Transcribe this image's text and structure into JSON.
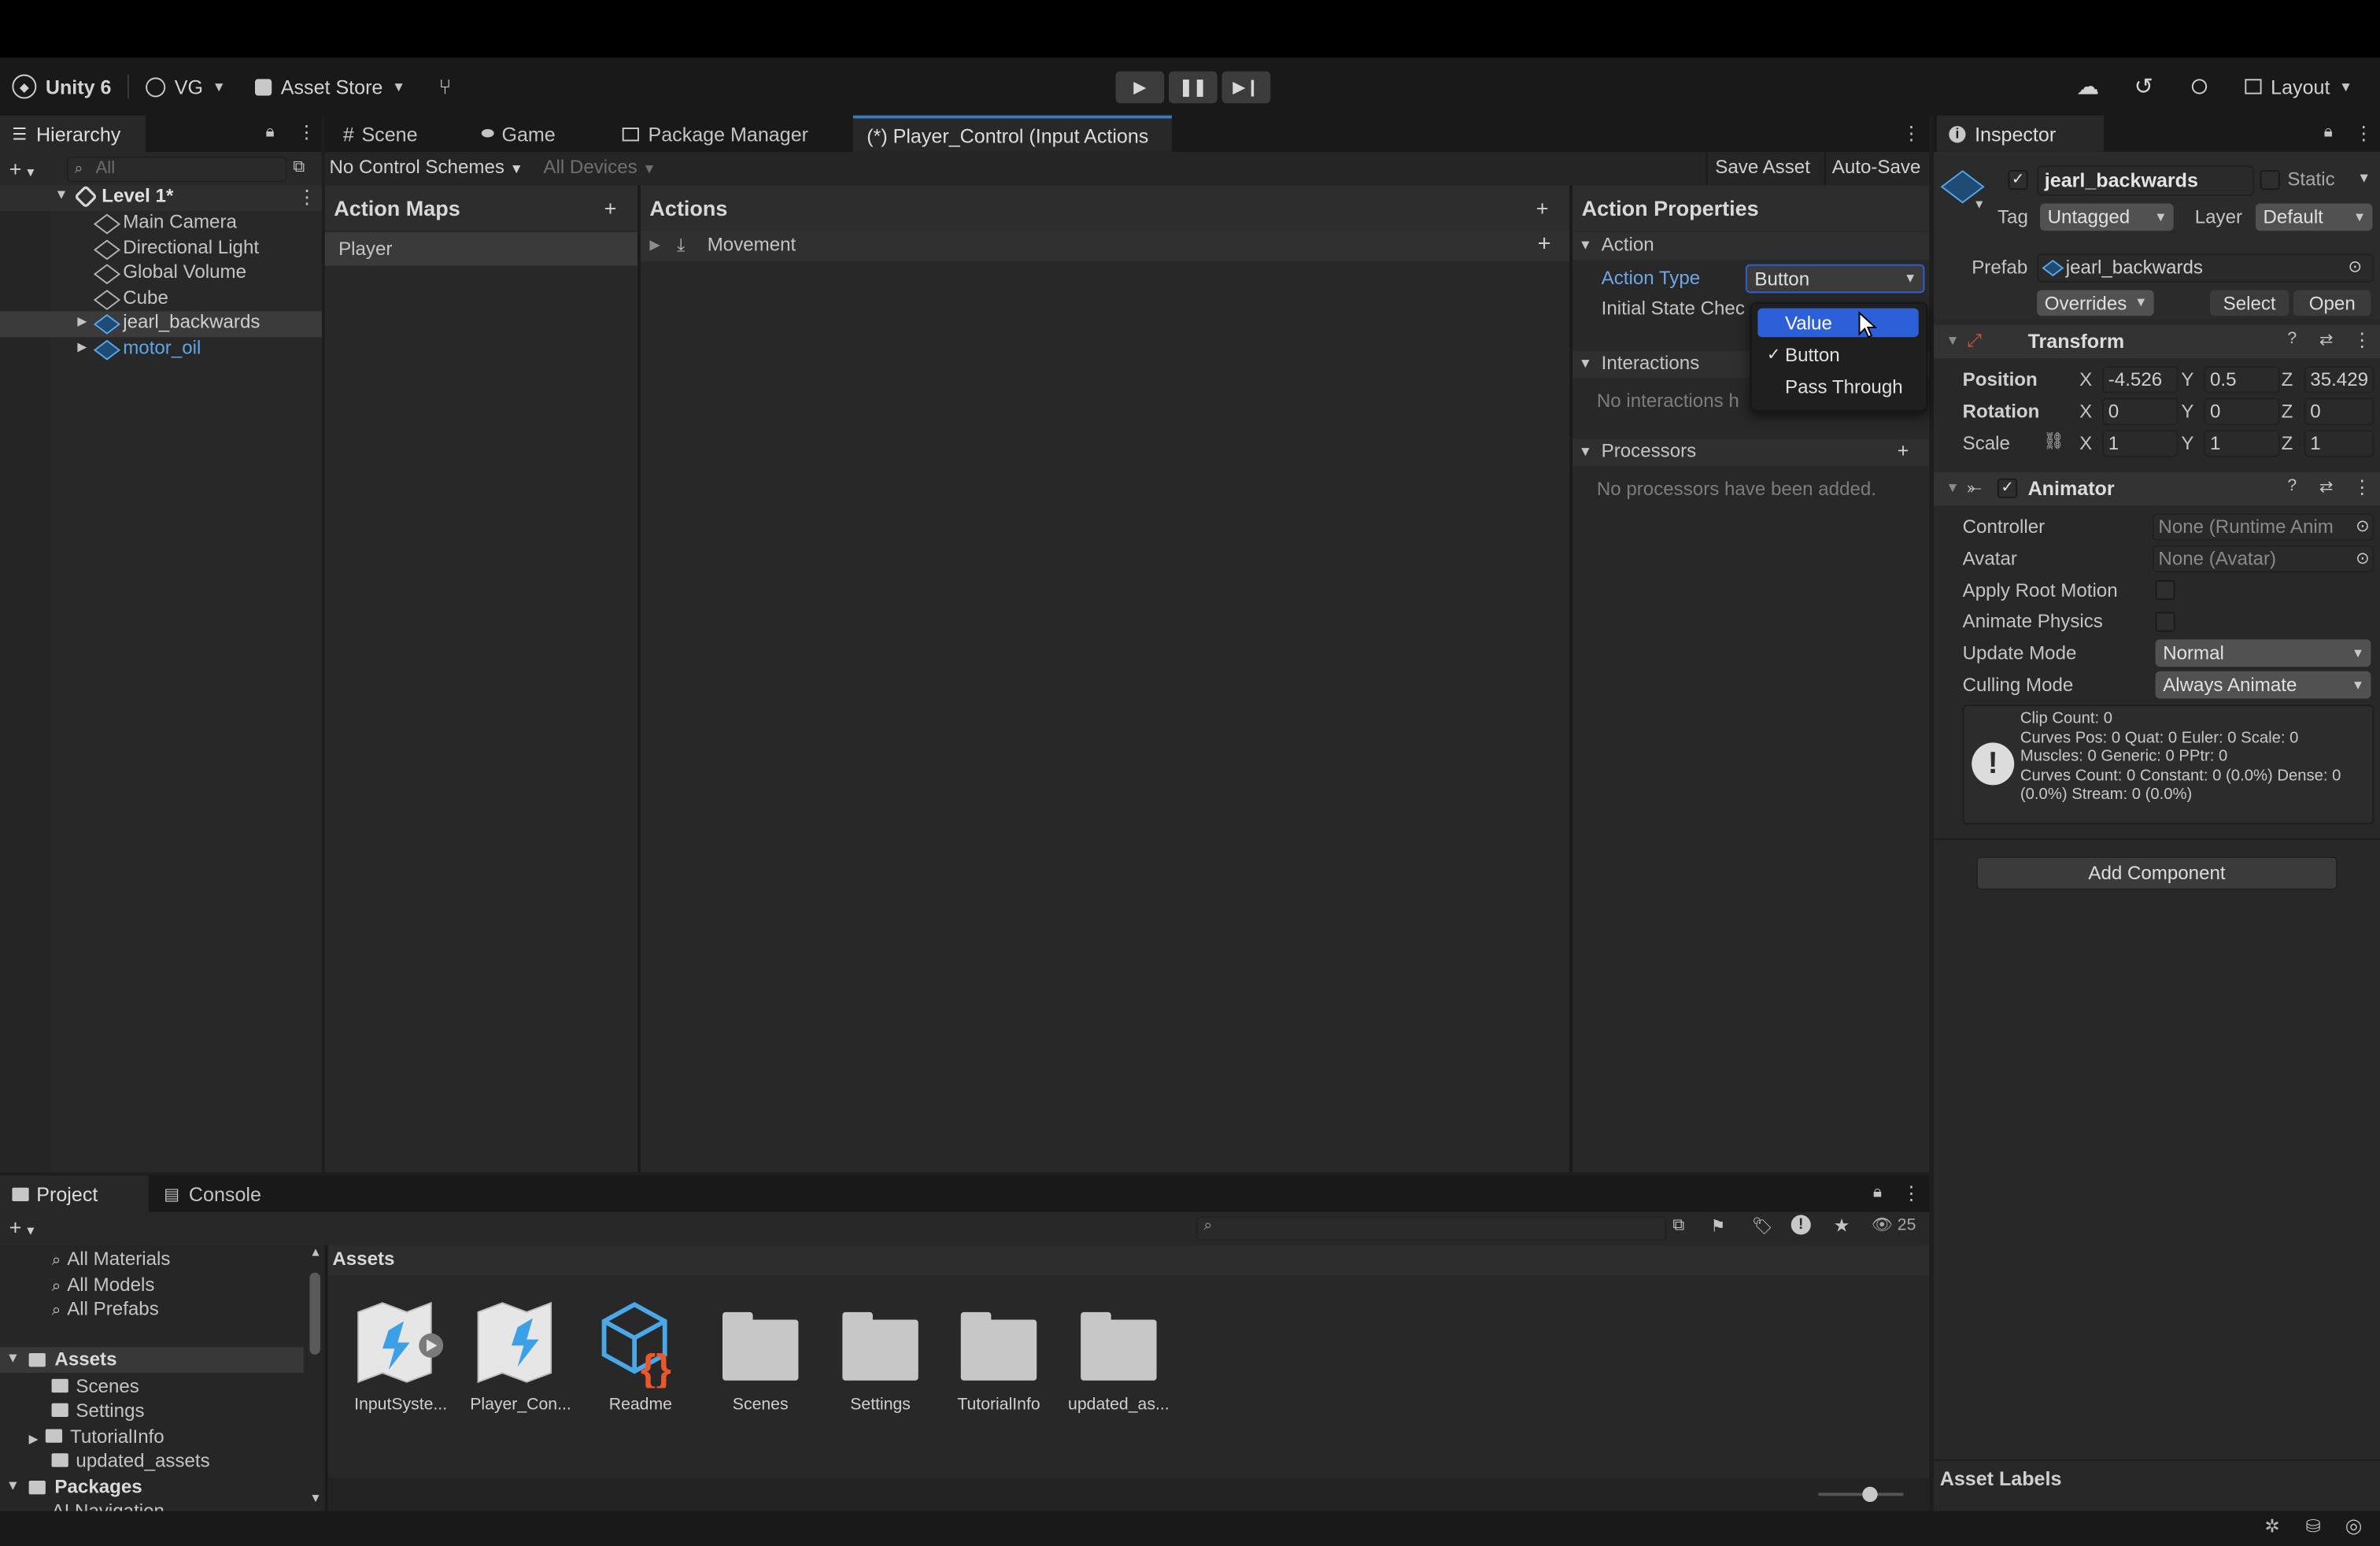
{
  "toolbar": {
    "app_title": "Unity 6",
    "account": "VG",
    "asset_store": "Asset Store",
    "layout": "Layout"
  },
  "hierarchy": {
    "tab_label": "Hierarchy",
    "search_placeholder": "All",
    "scene_name": "Level 1*",
    "items": [
      {
        "label": "Main Camera"
      },
      {
        "label": "Directional Light"
      },
      {
        "label": "Global Volume"
      },
      {
        "label": "Cube"
      },
      {
        "label": "jearl_backwards"
      },
      {
        "label": "motor_oil"
      }
    ]
  },
  "center_tabs": {
    "scene": "Scene",
    "game": "Game",
    "package_manager": "Package Manager",
    "input_actions": "(*) Player_Control (Input Actions"
  },
  "input_actions": {
    "control_schemes": "No Control Schemes",
    "devices": "All Devices",
    "save_asset": "Save Asset",
    "auto_save": "Auto-Save",
    "action_maps_title": "Action Maps",
    "action_maps": [
      "Player"
    ],
    "actions_title": "Actions",
    "actions": [
      "Movement"
    ],
    "properties_title": "Action Properties",
    "action_section": "Action",
    "action_type_label": "Action Type",
    "action_type_value": "Button",
    "initial_state_label": "Initial State Chec",
    "interactions_section": "Interactions",
    "interactions_empty": "No interactions h",
    "processors_section": "Processors",
    "processors_empty": "No processors have been added."
  },
  "dropdown": {
    "options": [
      "Value",
      "Button",
      "Pass Through"
    ],
    "selected": "Button",
    "highlighted": "Value"
  },
  "inspector": {
    "tab_label": "Inspector",
    "object_name": "jearl_backwards",
    "static_label": "Static",
    "tag_label": "Tag",
    "tag_value": "Untagged",
    "layer_label": "Layer",
    "layer_value": "Default",
    "prefab_label": "Prefab",
    "prefab_value": "jearl_backwards",
    "overrides": "Overrides",
    "select": "Select",
    "open": "Open",
    "transform": {
      "title": "Transform",
      "position_label": "Position",
      "rotation_label": "Rotation",
      "scale_label": "Scale",
      "axis_x": "X",
      "axis_y": "Y",
      "axis_z": "Z",
      "position": [
        "-4.526",
        "0.5",
        "35.429"
      ],
      "rotation": [
        "0",
        "0",
        "0"
      ],
      "scale": [
        "1",
        "1",
        "1"
      ]
    },
    "animator": {
      "title": "Animator",
      "controller_label": "Controller",
      "controller_value": "None (Runtime Anim",
      "avatar_label": "Avatar",
      "avatar_value": "None (Avatar)",
      "apply_root_motion_label": "Apply Root Motion",
      "animate_physics_label": "Animate Physics",
      "update_mode_label": "Update Mode",
      "update_mode_value": "Normal",
      "culling_mode_label": "Culling Mode",
      "culling_mode_value": "Always Animate",
      "info_lines": [
        "Clip Count: 0",
        "Curves Pos: 0 Quat: 0 Euler: 0 Scale: 0",
        "Muscles: 0 Generic: 0 PPtr: 0",
        "Curves Count: 0 Constant: 0 (0.0%) Dense: 0",
        "(0.0%) Stream: 0 (0.0%)"
      ]
    },
    "add_component": "Add Component",
    "asset_labels": "Asset Labels"
  },
  "project": {
    "tab_project": "Project",
    "tab_console": "Console",
    "hidden_count": "25",
    "favorites": [
      "All Materials",
      "All Models",
      "All Prefabs"
    ],
    "assets_root": "Assets",
    "asset_folders": [
      "Scenes",
      "Settings",
      "TutorialInfo",
      "updated_assets"
    ],
    "packages_root": "Packages",
    "packages_partial": "AI Navigation",
    "breadcrumb": "Assets",
    "grid_items": [
      {
        "label": "InputSyste...",
        "icon": "input-system-icon"
      },
      {
        "label": "Player_Con...",
        "icon": "input-actions-icon"
      },
      {
        "label": "Readme",
        "icon": "readme-script-icon"
      },
      {
        "label": "Scenes",
        "icon": "folder-icon"
      },
      {
        "label": "Settings",
        "icon": "folder-icon"
      },
      {
        "label": "TutorialInfo",
        "icon": "folder-icon"
      },
      {
        "label": "updated_as...",
        "icon": "folder-icon"
      }
    ]
  },
  "colors": {
    "accent": "#2c5fd8",
    "prefab_blue": "#5aa8ea",
    "tab_highlight": "#3a79bb"
  }
}
